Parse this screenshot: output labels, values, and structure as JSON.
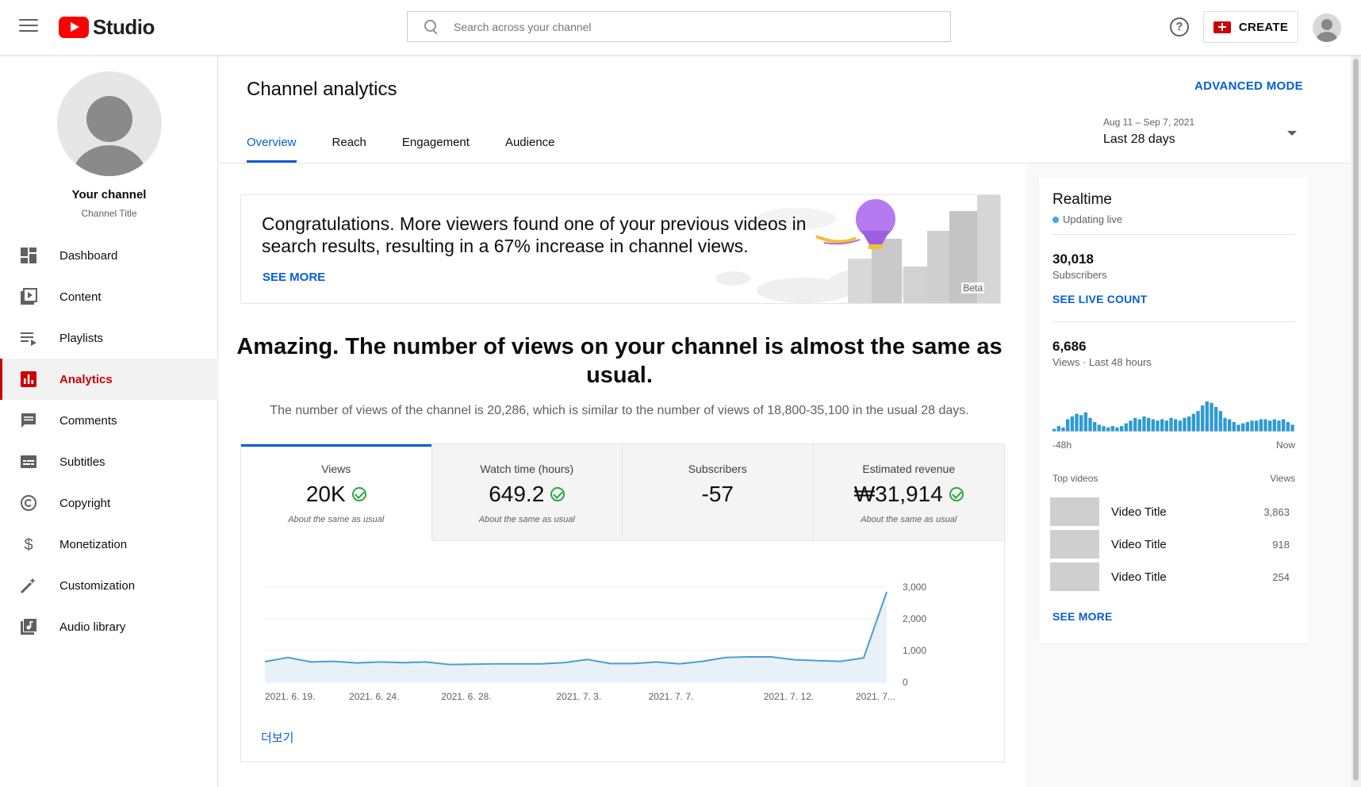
{
  "header": {
    "logo_text": "Studio",
    "search_placeholder": "Search across your channel",
    "help_icon_glyph": "?",
    "create_label": "CREATE"
  },
  "sidebar": {
    "channel_name": "Your channel",
    "channel_title": "Channel Title",
    "items": [
      {
        "label": "Dashboard",
        "icon": "dashboard-icon"
      },
      {
        "label": "Content",
        "icon": "content-icon"
      },
      {
        "label": "Playlists",
        "icon": "playlists-icon"
      },
      {
        "label": "Analytics",
        "icon": "analytics-icon",
        "active": true
      },
      {
        "label": "Comments",
        "icon": "comments-icon"
      },
      {
        "label": "Subtitles",
        "icon": "subtitles-icon"
      },
      {
        "label": "Copyright",
        "icon": "copyright-icon"
      },
      {
        "label": "Monetization",
        "icon": "monetization-icon"
      },
      {
        "label": "Customization",
        "icon": "customization-icon"
      },
      {
        "label": "Audio library",
        "icon": "audio-library-icon"
      }
    ]
  },
  "page": {
    "title": "Channel analytics",
    "advanced_mode": "ADVANCED MODE",
    "tabs": [
      "Overview",
      "Reach",
      "Engagement",
      "Audience"
    ],
    "active_tab": "Overview",
    "date_range_dates": "Aug 11 – Sep 7, 2021",
    "date_range_label": "Last 28 days"
  },
  "banner": {
    "text": "Congratulations. More viewers found one of your previous videos in search results, resulting in a 67% increase in channel views.",
    "see_more": "SEE MORE",
    "badge": "Beta"
  },
  "summary": {
    "headline": "Amazing. The number of views on your channel is almost the same as usual.",
    "detail": "The number of views of the channel is 20,286, which is similar to the number of views of 18,800-35,100 in the usual 28 days."
  },
  "metrics": [
    {
      "label": "Views",
      "value": "20K",
      "note": "About the same as usual",
      "check": true,
      "active": true
    },
    {
      "label": "Watch time (hours)",
      "value": "649.2",
      "note": "About the same as usual",
      "check": true
    },
    {
      "label": "Subscribers",
      "value": "-57",
      "note": "",
      "check": false
    },
    {
      "label": "Estimated revenue",
      "value": "₩31,914",
      "note": "About the same as usual",
      "check": true
    }
  ],
  "chart_more": "더보기",
  "chart_data": {
    "type": "area",
    "x_ticks": [
      "2021. 6. 19.",
      "2021. 6. 24.",
      "2021. 6. 28.",
      "2021. 7. 3.",
      "2021. 7. 7.",
      "2021. 7. 12.",
      "2021. 7..."
    ],
    "y_ticks": [
      "3,000",
      "2,000",
      "1,000",
      "0"
    ],
    "ylim": [
      0,
      3000
    ],
    "values": [
      650,
      780,
      640,
      660,
      610,
      640,
      620,
      640,
      560,
      570,
      580,
      580,
      580,
      620,
      720,
      590,
      590,
      640,
      580,
      660,
      780,
      800,
      800,
      710,
      680,
      660,
      770,
      2850
    ],
    "color": "#4a9fd1",
    "fill": "#e8f1f8"
  },
  "realtime": {
    "title": "Realtime",
    "status": "Updating live",
    "subscribers_value": "30,018",
    "subscribers_label": "Subscribers",
    "live_count_link": "SEE LIVE COUNT",
    "views_value": "6,686",
    "views_label": "Views · Last 48 hours",
    "axis_left": "-48h",
    "axis_right": "Now",
    "bars": [
      2,
      4,
      3,
      9,
      11,
      13,
      12,
      14,
      10,
      7,
      5,
      4,
      3,
      4,
      3,
      4,
      6,
      8,
      10,
      9,
      11,
      10,
      9,
      8,
      9,
      8,
      10,
      9,
      8,
      10,
      11,
      13,
      15,
      19,
      22,
      21,
      18,
      15,
      10,
      9,
      7,
      5,
      6,
      7,
      8,
      8,
      9,
      9,
      8,
      9,
      8,
      9,
      7,
      5
    ],
    "bar_color": "#2e9ad3",
    "top_videos_label": "Top videos",
    "views_col_label": "Views",
    "videos": [
      {
        "title": "Video Title",
        "views": "3,863"
      },
      {
        "title": "Video Title",
        "views": "918"
      },
      {
        "title": "Video Title",
        "views": "254"
      }
    ],
    "see_more": "SEE MORE"
  }
}
